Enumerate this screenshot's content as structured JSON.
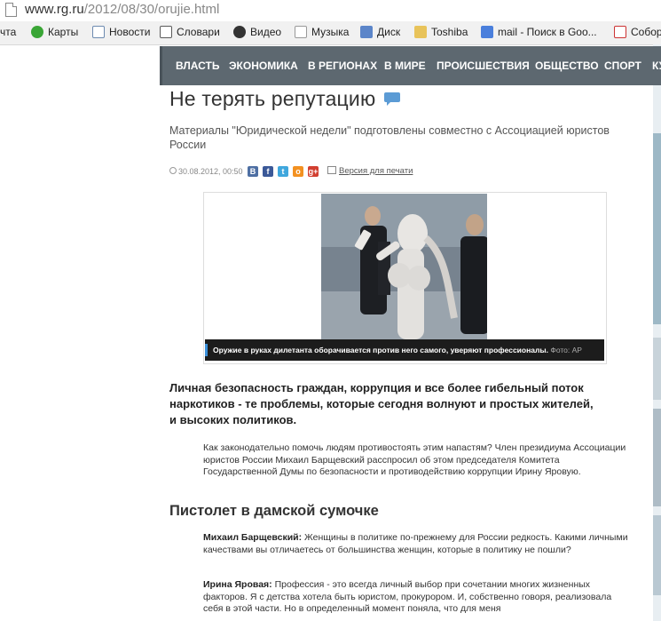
{
  "browser": {
    "url_host": "www.rg.ru",
    "url_path": "/2012/08/30/orujie.html"
  },
  "bookmarks": [
    {
      "label": "чта",
      "icon": "mail-icon",
      "color": "#ffffff"
    },
    {
      "label": "Карты",
      "icon": "maps-icon",
      "color": "#3aa636"
    },
    {
      "label": "Новости",
      "icon": "news-icon",
      "color": "#6d8bb0"
    },
    {
      "label": "Словари",
      "icon": "dictionary-icon",
      "color": "#5a5a5a"
    },
    {
      "label": "Видео",
      "icon": "video-icon",
      "color": "#333333"
    },
    {
      "label": "Музыка",
      "icon": "music-icon",
      "color": "#ffffff"
    },
    {
      "label": "Диск",
      "icon": "disk-icon",
      "color": "#5b85c9"
    },
    {
      "label": "Toshiba",
      "icon": "folder-icon",
      "color": "#e8c35a"
    },
    {
      "label": "mail - Поиск в Goo...",
      "icon": "google-icon",
      "color": "#4a7fdc"
    },
    {
      "label": "Собор",
      "icon": "yandex-icon",
      "color": "#ffffff"
    }
  ],
  "nav": {
    "items": [
      "ВЛАСТЬ",
      "ЭКОНОМИКА",
      "В РЕГИОНАХ",
      "В МИРЕ",
      "ПРОИСШЕСТВИЯ",
      "ОБЩЕСТВО",
      "СПОРТ",
      "КУ"
    ]
  },
  "article": {
    "title": "Не терять репутацию",
    "subtitle": "Материалы \"Юридической недели\" подготовлены совместно с Ассоциацией юристов России",
    "date": "30.08.2012, 00:50",
    "social": [
      {
        "label": "B",
        "icon": "vkontakte-icon",
        "color": "#4e6fa3"
      },
      {
        "label": "f",
        "icon": "facebook-icon",
        "color": "#3b5998"
      },
      {
        "label": "t",
        "icon": "twitter-icon",
        "color": "#3fa7dd"
      },
      {
        "label": "o",
        "icon": "odnoklassniki-icon",
        "color": "#f39121"
      },
      {
        "label": "g+",
        "icon": "google-plus-icon",
        "color": "#d23f31"
      }
    ],
    "print_label": "Версия для печати",
    "photo_caption": "Оружие в руках дилетанта оборачивается против него самого, уверяют профессионалы.",
    "photo_source": "Фото: AP",
    "lead": "Личная безопасность граждан, коррупция и все более гибельный поток наркотиков - те проблемы, которые сегодня волнуют и простых жителей, и высоких политиков.",
    "intro": "Как законодательно помочь людям противостоять этим напастям? Член президиума Ассоциации юристов России Михаил Барщевский расспросил об этом председателя Комитета Государственной Думы по безопасности и противодействию коррупции Ирину Яровую.",
    "section_heading": "Пистолет в дамской сумочке",
    "q1_speaker": "Михаил Барщевский:",
    "q1_text": " Женщины в политике по-прежнему для России редкость. Какими личными качествами вы отличаетесь от большинства женщин, которые в политику не пошли?",
    "a1_speaker": "Ирина Яровая:",
    "a1_text": " Профессия - это всегда личный выбор при сочетании многих жизненных факторов. Я с детства хотела быть юристом, прокурором. И, собственно говоря, реализовала себя в этой части. Но в определенный момент поняла, что для меня"
  }
}
